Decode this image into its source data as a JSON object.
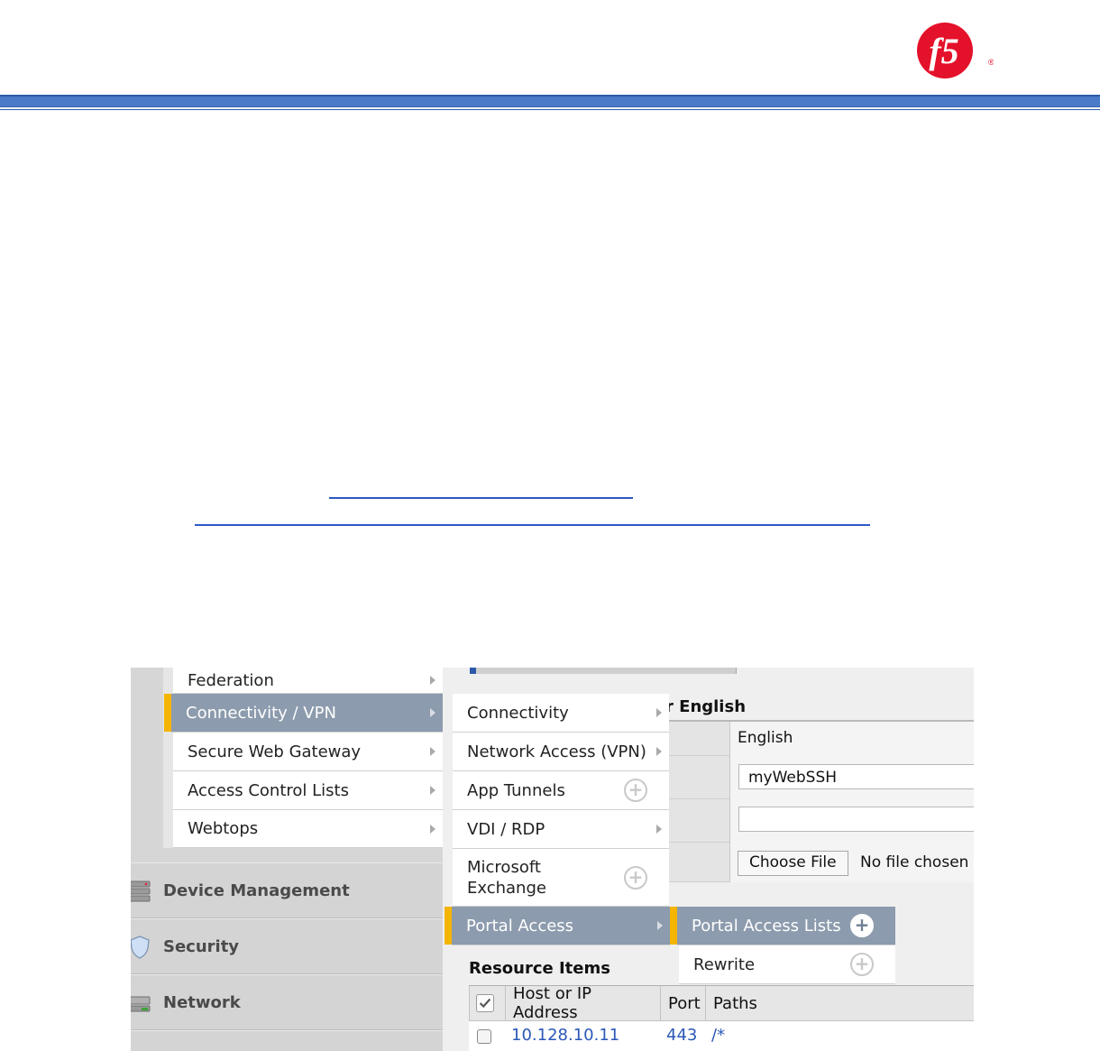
{
  "colors": {
    "brand_red": "#e4112a",
    "header_blue": "#4a7bc8",
    "link_blue": "#2d59c6",
    "menu_selected": "#8c9bad",
    "menu_marker": "#f4b400"
  },
  "logo": {
    "icon": "f5-logo-icon",
    "reg_mark": "®"
  },
  "nav": {
    "menu": [
      {
        "label": "Federation",
        "selected": false
      },
      {
        "label": "Connectivity / VPN",
        "selected": true
      },
      {
        "label": "Secure Web Gateway",
        "selected": false
      },
      {
        "label": "Access Control Lists",
        "selected": false
      },
      {
        "label": "Webtops",
        "selected": false
      }
    ],
    "sections": [
      {
        "label": "Device Management",
        "icon": "server-icon"
      },
      {
        "label": "Security",
        "icon": "shield-icon"
      },
      {
        "label": "Network",
        "icon": "network-icon"
      }
    ]
  },
  "submenu": [
    {
      "label": "Connectivity",
      "type": "arrow"
    },
    {
      "label": "Network Access (VPN)",
      "type": "arrow"
    },
    {
      "label": "App Tunnels",
      "type": "plus"
    },
    {
      "label": "VDI / RDP",
      "type": "arrow"
    },
    {
      "label": "Microsoft Exchange",
      "type": "plus"
    },
    {
      "label": "Portal Access",
      "type": "arrow",
      "selected": true
    }
  ],
  "flyout": [
    {
      "label": "Portal Access Lists",
      "selected": true
    },
    {
      "label": "Rewrite",
      "selected": false
    }
  ],
  "form": {
    "heading_fragment": "r English",
    "language_value": "English",
    "name_value": "myWebSSH",
    "empty_value": "",
    "choose_file_label": "Choose File",
    "no_file_label": "No file chosen"
  },
  "resources": {
    "title": "Resource Items",
    "columns": [
      "Host or IP Address",
      "Port",
      "Paths"
    ],
    "rows": [
      {
        "host": "10.128.10.11",
        "port": "443",
        "path": "/*"
      }
    ]
  }
}
